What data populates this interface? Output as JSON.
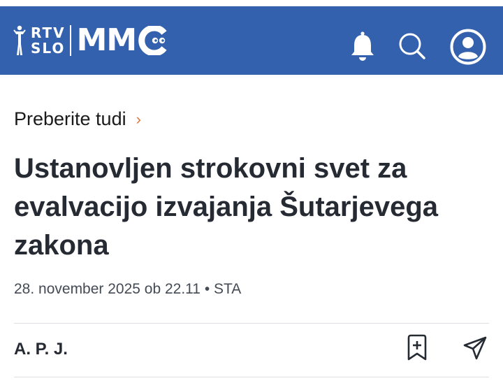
{
  "header": {
    "logo_rtv_line1": "RTV",
    "logo_rtv_line2": "SLO",
    "logo_mmc": "MM",
    "icons": [
      "notification-bell-icon",
      "search-icon",
      "user-account-icon"
    ],
    "colors": {
      "bar": "#3461ad",
      "foreground": "#ffffff"
    }
  },
  "related": {
    "label": "Preberite tudi",
    "chevron": "›",
    "chevron_color": "#e0743a"
  },
  "article": {
    "title": "Ustanovljen strokovni svet za evalvacijo izvajanja Šutarjevega zakona",
    "meta": "28. november 2025 ob 22.11 • STA",
    "author": "A. P. J."
  },
  "actions": {
    "icons": [
      "bookmark-add-icon",
      "share-icon"
    ]
  }
}
